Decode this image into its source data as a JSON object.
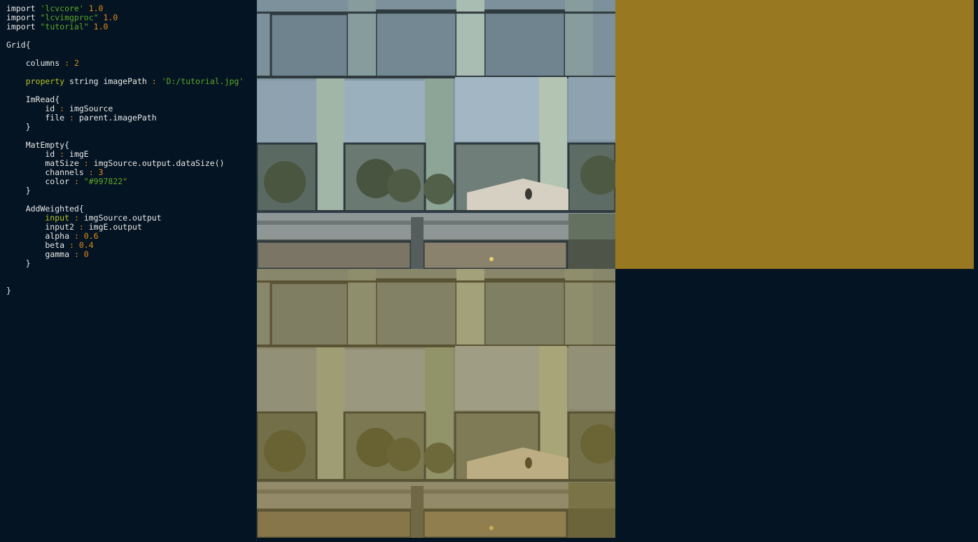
{
  "editor": {
    "lines": [
      [
        {
          "t": "import ",
          "c": "kw"
        },
        {
          "t": "'lcvcore'",
          "c": "str"
        },
        {
          "t": " 1.0",
          "c": "num"
        }
      ],
      [
        {
          "t": "import ",
          "c": "kw"
        },
        {
          "t": "\"lcvimgproc\"",
          "c": "str"
        },
        {
          "t": " 1.0",
          "c": "num"
        }
      ],
      [
        {
          "t": "import ",
          "c": "kw"
        },
        {
          "t": "\"tutorial\"",
          "c": "str"
        },
        {
          "t": " 1.0",
          "c": "num"
        }
      ],
      [],
      [
        {
          "t": "Grid{",
          "c": "kw"
        }
      ],
      [],
      [
        {
          "t": "    columns ",
          "c": "kw"
        },
        {
          "t": ":",
          "c": "punc"
        },
        {
          "t": " 2",
          "c": "num"
        }
      ],
      [],
      [
        {
          "t": "    property",
          "c": "prop"
        },
        {
          "t": " string imagePath ",
          "c": "kw"
        },
        {
          "t": ":",
          "c": "punc"
        },
        {
          "t": " 'D:/tutorial.jpg'",
          "c": "str"
        }
      ],
      [],
      [
        {
          "t": "    ImRead{",
          "c": "kw"
        }
      ],
      [
        {
          "t": "        id ",
          "c": "kw"
        },
        {
          "t": ":",
          "c": "punc"
        },
        {
          "t": " imgSource",
          "c": "kw"
        }
      ],
      [
        {
          "t": "        file ",
          "c": "kw"
        },
        {
          "t": ":",
          "c": "punc"
        },
        {
          "t": " parent.imagePath",
          "c": "kw"
        }
      ],
      [
        {
          "t": "    }",
          "c": "kw"
        }
      ],
      [],
      [
        {
          "t": "    MatEmpty{",
          "c": "kw"
        }
      ],
      [
        {
          "t": "        id ",
          "c": "kw"
        },
        {
          "t": ":",
          "c": "punc"
        },
        {
          "t": " imgE",
          "c": "kw"
        }
      ],
      [
        {
          "t": "        matSize ",
          "c": "kw"
        },
        {
          "t": ":",
          "c": "punc"
        },
        {
          "t": " imgSource.output.dataSize()",
          "c": "kw"
        }
      ],
      [
        {
          "t": "        channels ",
          "c": "kw"
        },
        {
          "t": ":",
          "c": "punc"
        },
        {
          "t": " 3",
          "c": "num"
        }
      ],
      [
        {
          "t": "        color ",
          "c": "kw"
        },
        {
          "t": ":",
          "c": "punc"
        },
        {
          "t": " \"#997822\"",
          "c": "str"
        }
      ],
      [
        {
          "t": "    }",
          "c": "kw"
        }
      ],
      [],
      [
        {
          "t": "    AddWeighted{",
          "c": "kw"
        }
      ],
      [
        {
          "t": "        input",
          "c": "prop"
        },
        {
          "t": " ",
          "c": "kw"
        },
        {
          "t": ":",
          "c": "punc"
        },
        {
          "t": " imgSource.output",
          "c": "kw"
        }
      ],
      [
        {
          "t": "        input2 ",
          "c": "kw"
        },
        {
          "t": ":",
          "c": "punc"
        },
        {
          "t": " imgE.output",
          "c": "kw"
        }
      ],
      [
        {
          "t": "        alpha ",
          "c": "kw"
        },
        {
          "t": ":",
          "c": "punc"
        },
        {
          "t": " 0.6",
          "c": "num"
        }
      ],
      [
        {
          "t": "        beta ",
          "c": "kw"
        },
        {
          "t": ":",
          "c": "punc"
        },
        {
          "t": " 0.4",
          "c": "num"
        }
      ],
      [
        {
          "t": "        gamma ",
          "c": "kw"
        },
        {
          "t": ":",
          "c": "punc"
        },
        {
          "t": " 0",
          "c": "num"
        }
      ],
      [
        {
          "t": "    }",
          "c": "kw"
        }
      ],
      [],
      [],
      [
        {
          "t": "}",
          "c": "kw"
        }
      ]
    ]
  },
  "grid": {
    "columns": 2,
    "empty_color": "#997822",
    "blend_alpha": 0.6,
    "blend_beta": 0.4
  },
  "colors": {
    "background": "#041422",
    "string": "#5fa628",
    "number": "#e08a1a",
    "property": "#b8c228",
    "text": "#e8e8e8"
  }
}
